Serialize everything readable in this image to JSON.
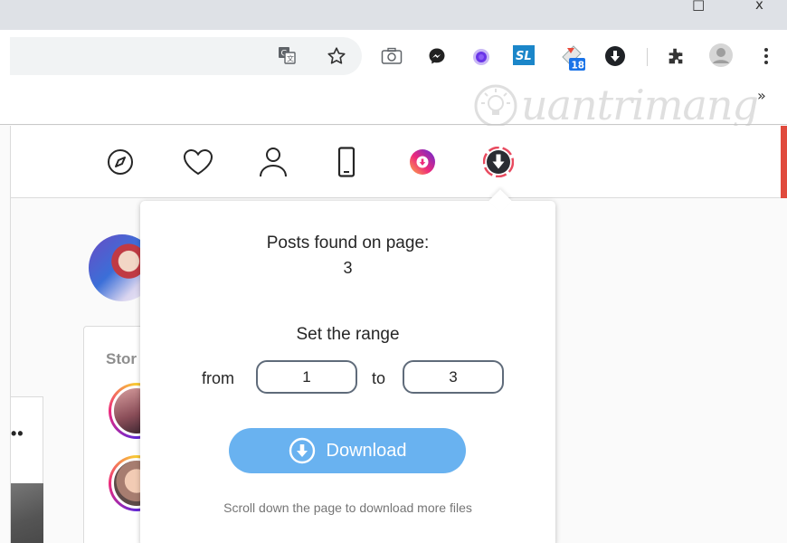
{
  "window": {
    "minimize_glyph": "□",
    "close_glyph": "x"
  },
  "toolbar": {
    "icons": [
      "translate-icon",
      "bookmark-star-icon",
      "camera-icon",
      "messenger-icon",
      "extension-purple-icon",
      "extension-sl-icon",
      "extension-badge-icon",
      "downloader-icon",
      "extensions-puzzle-icon",
      "profile-avatar-icon",
      "menu-kebab-icon"
    ],
    "badge_count": "18",
    "sl_label": "SL"
  },
  "bookmarks": {
    "more_glyph": "»"
  },
  "watermark": {
    "text": "uantrimang"
  },
  "ig_nav": {
    "icons": [
      "explore-compass-icon",
      "activity-heart-icon",
      "profile-person-icon",
      "mobile-phone-icon",
      "instagram-downloader-icon",
      "downloader-extension-icon"
    ]
  },
  "sidebar": {
    "stories_title": "Stor",
    "feed_dots": "• •"
  },
  "popup": {
    "posts_label": "Posts found on page:",
    "posts_count": "3",
    "range_label": "Set the range",
    "from_label": "from",
    "from_value": "1",
    "to_label": "to",
    "to_value": "3",
    "download_label": "Download",
    "hint": "Scroll down the page to download more files"
  },
  "colors": {
    "download_button": "#69b2f0",
    "input_border": "#5f6b7a"
  }
}
